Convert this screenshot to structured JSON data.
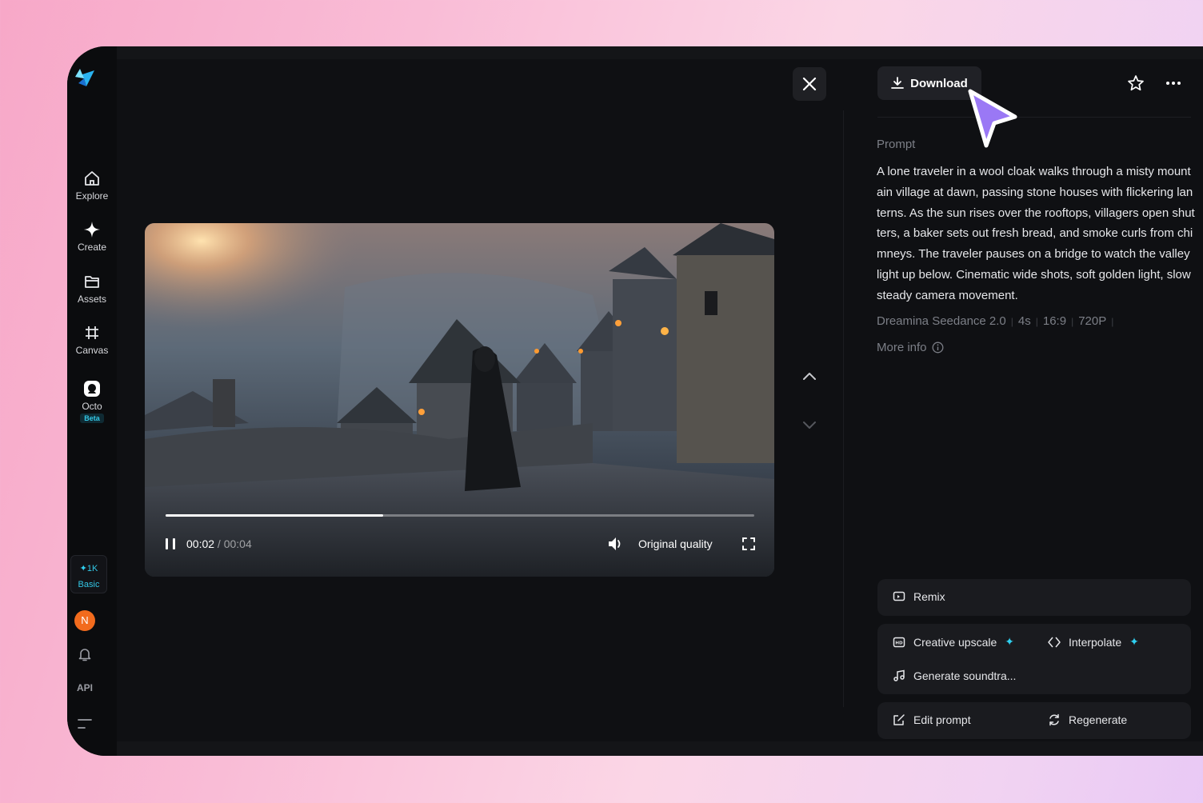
{
  "sidebar": {
    "items": [
      {
        "label": "Explore",
        "icon": "home-icon"
      },
      {
        "label": "Create",
        "icon": "sparkle-icon"
      },
      {
        "label": "Assets",
        "icon": "folder-icon"
      },
      {
        "label": "Canvas",
        "icon": "crop-grid-icon"
      },
      {
        "label": "Octo",
        "icon": "octo-icon",
        "badge": "Beta"
      }
    ],
    "credits": {
      "amount": "1K",
      "plan": "Basic"
    },
    "avatar_initial": "N",
    "api_label": "API"
  },
  "player": {
    "current_time": "00:02",
    "duration": "00:04",
    "time_separator": " / ",
    "progress_fraction": 0.37,
    "quality_label": "Original quality"
  },
  "panel": {
    "download_label": "Download",
    "prompt_label": "Prompt",
    "prompt_text": "A lone traveler in a wool cloak walks through a misty mountain village at dawn, passing stone houses with flickering lanterns. As the sun rises over the rooftops, villagers open shutters, a baker sets out fresh bread, and smoke curls from chimneys. The traveler pauses on a bridge to watch the valley light up below. Cinematic wide shots, soft golden light, slow steady camera movement.",
    "meta": {
      "model": "Dreamina Seedance 2.0",
      "length": "4s",
      "ratio": "16:9",
      "resolution": "720P"
    },
    "more_info_label": "More info",
    "actions": {
      "remix": "Remix",
      "creative_upscale": "Creative upscale",
      "interpolate": "Interpolate",
      "generate_soundtrack": "Generate soundtra...",
      "edit_prompt": "Edit prompt",
      "regenerate": "Regenerate"
    }
  },
  "colors": {
    "accent": "#2fd0f0",
    "cursor": "#9a78f5",
    "avatar": "#f26b1d"
  }
}
